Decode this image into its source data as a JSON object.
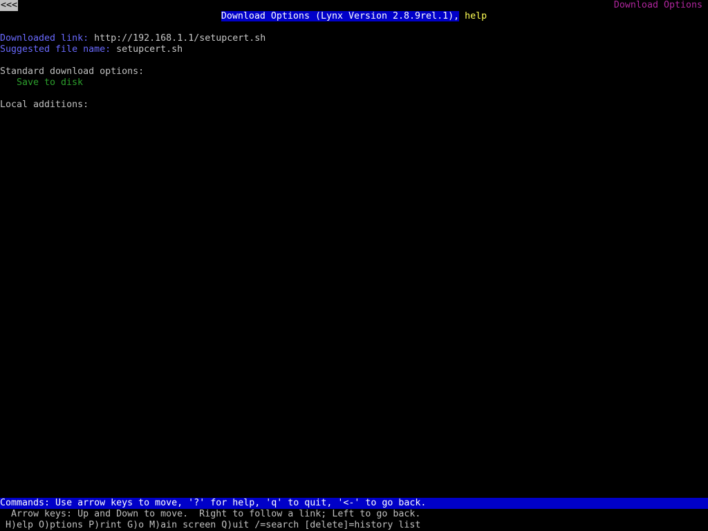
{
  "top": {
    "back_link": "<<<",
    "page_id": "Download Options"
  },
  "title": {
    "main": "Download Options (Lynx Version 2.8.9rel.1),",
    "help": "help"
  },
  "downloaded": {
    "label": "Downloaded link:",
    "value": "http://192.168.1.1/setupcert.sh"
  },
  "suggested": {
    "label": "Suggested file name:",
    "value": "setupcert.sh"
  },
  "standard": {
    "heading": "Standard download options:",
    "options": [
      "Save to disk"
    ]
  },
  "local": {
    "heading": "Local additions:"
  },
  "footer": {
    "commands": "Commands: Use arrow keys to move, '?' for help, 'q' to quit, '<-' to go back.",
    "arrows": "Arrow keys: Up and Down to move.  Right to follow a link; Left to go back.",
    "keys": "H)elp O)ptions P)rint G)o M)ain screen Q)uit /=search [delete]=history list"
  },
  "colors": {
    "background": "#000000",
    "link_label": "#6a6aff",
    "option_link": "#2ca02c",
    "highlight_bar": "#0000c8",
    "page_id": "#b0269e",
    "help_link": "#ffff55"
  }
}
